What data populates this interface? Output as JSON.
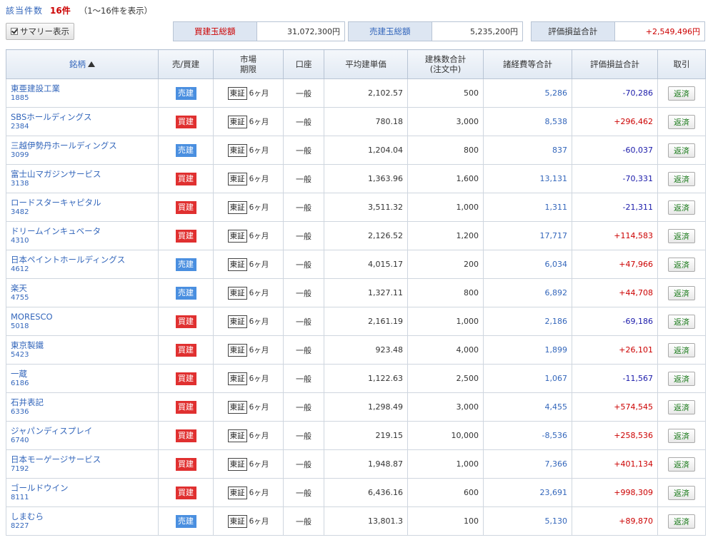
{
  "header": {
    "count_label": "該当件数",
    "count_value": "16件",
    "count_note": "（1～16件を表示）",
    "summary_button": "サマリー表示"
  },
  "summary": {
    "buy_label": "買建玉総額",
    "buy_value": "31,072,300円",
    "sell_label": "売建玉総額",
    "sell_value": "5,235,200円",
    "pl_label": "評価損益合計",
    "pl_value": "+2,549,496円"
  },
  "columns": {
    "name": "銘柄",
    "side": "売/買建",
    "market_line1": "市場",
    "market_line2": "期限",
    "account": "口座",
    "avg_price": "平均建単価",
    "qty_line1": "建株数合計",
    "qty_line2": "(注文中)",
    "expenses": "諸経費等合計",
    "pl": "評価損益合計",
    "trade": "取引"
  },
  "rows": [
    {
      "name": "東亜建設工業",
      "code": "1885",
      "side": "売建",
      "type": "sell",
      "market": "東証",
      "term": "6ヶ月",
      "account": "一般",
      "avg": "2,102.57",
      "qty": "500",
      "exp": "5,286",
      "pl": "-70,286",
      "action": "返済"
    },
    {
      "name": "SBSホールディングス",
      "code": "2384",
      "side": "買建",
      "type": "buy",
      "market": "東証",
      "term": "6ヶ月",
      "account": "一般",
      "avg": "780.18",
      "qty": "3,000",
      "exp": "8,538",
      "pl": "+296,462",
      "action": "返済"
    },
    {
      "name": "三越伊勢丹ホールディングス",
      "code": "3099",
      "side": "売建",
      "type": "sell",
      "market": "東証",
      "term": "6ヶ月",
      "account": "一般",
      "avg": "1,204.04",
      "qty": "800",
      "exp": "837",
      "pl": "-60,037",
      "action": "返済"
    },
    {
      "name": "富士山マガジンサービス",
      "code": "3138",
      "side": "買建",
      "type": "buy",
      "market": "東証",
      "term": "6ヶ月",
      "account": "一般",
      "avg": "1,363.96",
      "qty": "1,600",
      "exp": "13,131",
      "pl": "-70,331",
      "action": "返済"
    },
    {
      "name": "ロードスターキャピタル",
      "code": "3482",
      "side": "買建",
      "type": "buy",
      "market": "東証",
      "term": "6ヶ月",
      "account": "一般",
      "avg": "3,511.32",
      "qty": "1,000",
      "exp": "1,311",
      "pl": "-21,311",
      "action": "返済"
    },
    {
      "name": "ドリームインキュベータ",
      "code": "4310",
      "side": "買建",
      "type": "buy",
      "market": "東証",
      "term": "6ヶ月",
      "account": "一般",
      "avg": "2,126.52",
      "qty": "1,200",
      "exp": "17,717",
      "pl": "+114,583",
      "action": "返済"
    },
    {
      "name": "日本ペイントホールディングス",
      "code": "4612",
      "side": "売建",
      "type": "sell",
      "market": "東証",
      "term": "6ヶ月",
      "account": "一般",
      "avg": "4,015.17",
      "qty": "200",
      "exp": "6,034",
      "pl": "+47,966",
      "action": "返済"
    },
    {
      "name": "楽天",
      "code": "4755",
      "side": "売建",
      "type": "sell",
      "market": "東証",
      "term": "6ヶ月",
      "account": "一般",
      "avg": "1,327.11",
      "qty": "800",
      "exp": "6,892",
      "pl": "+44,708",
      "action": "返済"
    },
    {
      "name": "MORESCO",
      "code": "5018",
      "side": "買建",
      "type": "buy",
      "market": "東証",
      "term": "6ヶ月",
      "account": "一般",
      "avg": "2,161.19",
      "qty": "1,000",
      "exp": "2,186",
      "pl": "-69,186",
      "action": "返済"
    },
    {
      "name": "東京製鐵",
      "code": "5423",
      "side": "買建",
      "type": "buy",
      "market": "東証",
      "term": "6ヶ月",
      "account": "一般",
      "avg": "923.48",
      "qty": "4,000",
      "exp": "1,899",
      "pl": "+26,101",
      "action": "返済"
    },
    {
      "name": "一蔵",
      "code": "6186",
      "side": "買建",
      "type": "buy",
      "market": "東証",
      "term": "6ヶ月",
      "account": "一般",
      "avg": "1,122.63",
      "qty": "2,500",
      "exp": "1,067",
      "pl": "-11,567",
      "action": "返済"
    },
    {
      "name": "石井表記",
      "code": "6336",
      "side": "買建",
      "type": "buy",
      "market": "東証",
      "term": "6ヶ月",
      "account": "一般",
      "avg": "1,298.49",
      "qty": "3,000",
      "exp": "4,455",
      "pl": "+574,545",
      "action": "返済"
    },
    {
      "name": "ジャパンディスプレイ",
      "code": "6740",
      "side": "買建",
      "type": "buy",
      "market": "東証",
      "term": "6ヶ月",
      "account": "一般",
      "avg": "219.15",
      "qty": "10,000",
      "exp": "-8,536",
      "pl": "+258,536",
      "action": "返済"
    },
    {
      "name": "日本モーゲージサービス",
      "code": "7192",
      "side": "買建",
      "type": "buy",
      "market": "東証",
      "term": "6ヶ月",
      "account": "一般",
      "avg": "1,948.87",
      "qty": "1,000",
      "exp": "7,366",
      "pl": "+401,134",
      "action": "返済"
    },
    {
      "name": "ゴールドウイン",
      "code": "8111",
      "side": "買建",
      "type": "buy",
      "market": "東証",
      "term": "6ヶ月",
      "account": "一般",
      "avg": "6,436.16",
      "qty": "600",
      "exp": "23,691",
      "pl": "+998,309",
      "action": "返済"
    },
    {
      "name": "しまむら",
      "code": "8227",
      "side": "売建",
      "type": "sell",
      "market": "東証",
      "term": "6ヶ月",
      "account": "一般",
      "avg": "13,801.3",
      "qty": "100",
      "exp": "5,130",
      "pl": "+89,870",
      "action": "返済"
    }
  ],
  "colors": {
    "buy_badge": "#e03030",
    "sell_badge": "#4a8fe0",
    "positive": "#cc0000",
    "negative": "#1a1aaa",
    "link": "#3366bb"
  },
  "icons": {
    "checkbox": "checkbox-checked-icon",
    "sort": "sort-ascending-icon"
  }
}
